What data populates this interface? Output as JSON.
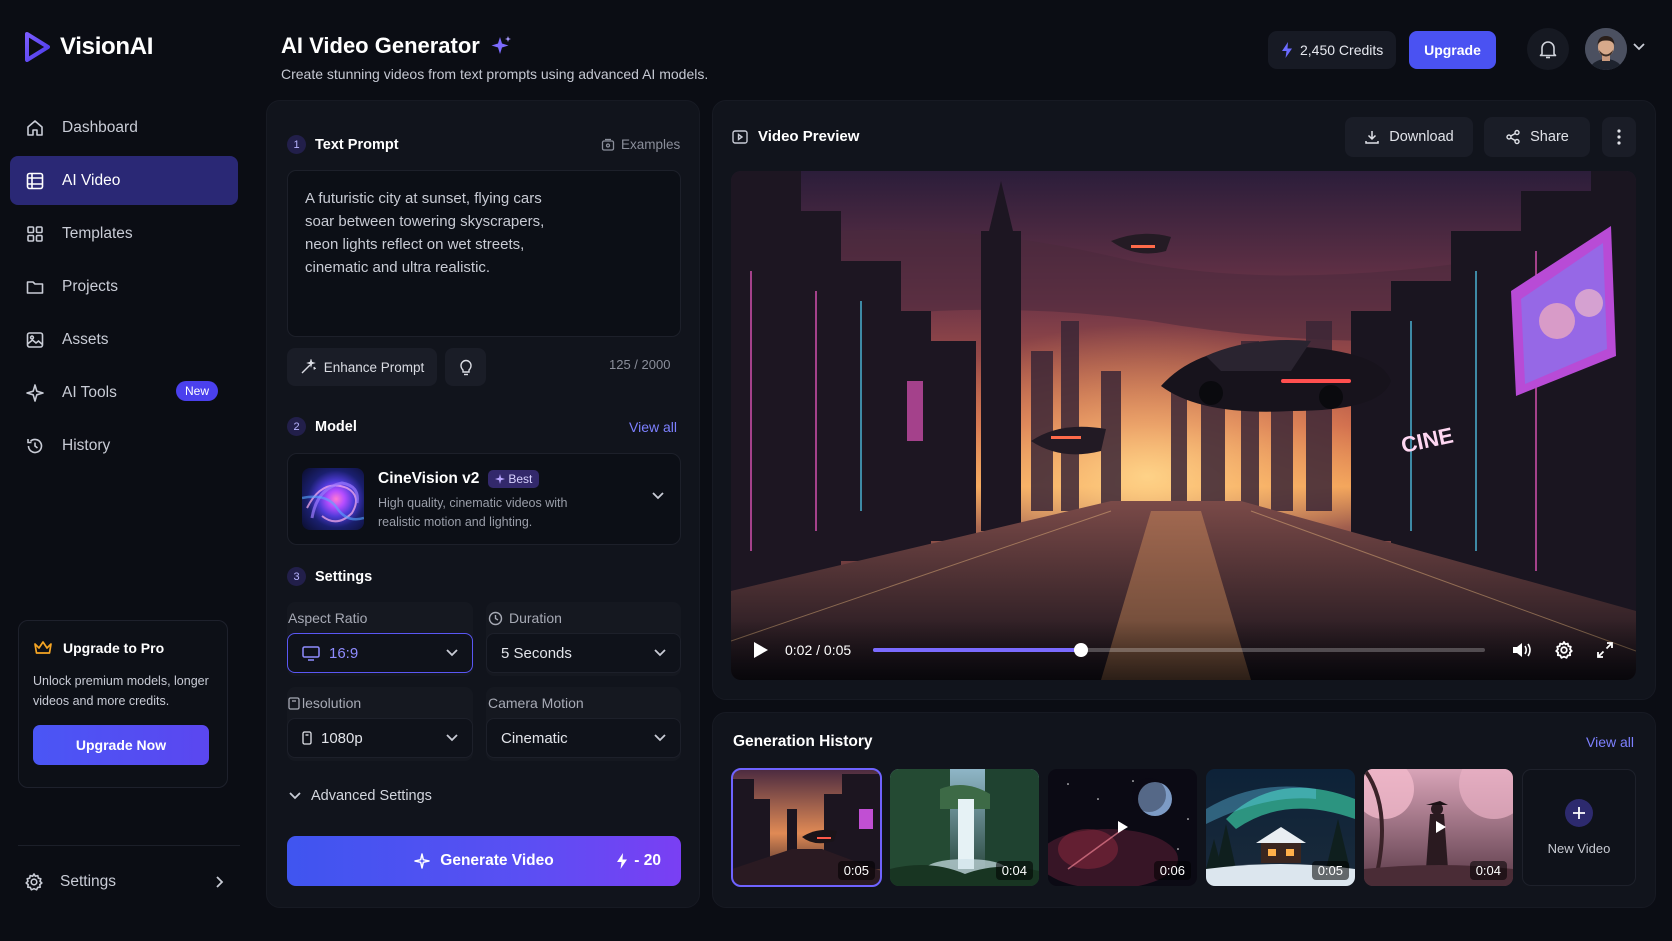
{
  "app": {
    "name": "VisionAI"
  },
  "sidebar": {
    "items": [
      {
        "label": "Dashboard"
      },
      {
        "label": "AI Video"
      },
      {
        "label": "Templates"
      },
      {
        "label": "Projects"
      },
      {
        "label": "Assets"
      },
      {
        "label": "AI Tools",
        "badge": "New"
      },
      {
        "label": "History"
      }
    ],
    "promo": {
      "title": "Upgrade to Pro",
      "text": "Unlock premium models, longer videos and more credits.",
      "button": "Upgrade Now"
    },
    "settings_label": "Settings"
  },
  "header": {
    "title": "AI Video Generator",
    "subtitle": "Create stunning videos from text prompts using advanced AI models.",
    "credits": "2,450 Credits",
    "upgrade": "Upgrade"
  },
  "prompt": {
    "step": "1",
    "title": "Text Prompt",
    "examples": "Examples",
    "text": "A futuristic city at sunset, flying cars soar between towering skyscrapers, neon lights reflect on wet streets, cinematic and ultra realistic.",
    "enhance": "Enhance Prompt",
    "counter": "125 / 2000"
  },
  "model": {
    "step": "2",
    "title": "Model",
    "view_all": "View all",
    "name": "CineVision v2",
    "badge": "Best",
    "description": "High quality, cinematic videos with realistic motion and lighting."
  },
  "settings": {
    "step": "3",
    "title": "Settings",
    "aspect_label": "Aspect Ratio",
    "aspect_value": "16:9",
    "duration_label": "Duration",
    "duration_value": "5 Seconds",
    "resolution_label": "lesolution",
    "resolution_value": "1080p",
    "camera_label": "Camera Motion",
    "camera_value": "Cinematic",
    "advanced": "Advanced Settings"
  },
  "generate": {
    "label": "Generate Video",
    "cost": "- 20"
  },
  "preview": {
    "title": "Video Preview",
    "download": "Download",
    "share": "Share",
    "time": "0:02 / 0:05",
    "progress": 0.34,
    "billboard_text": "CINE"
  },
  "history": {
    "title": "Generation History",
    "view_all": "View all",
    "items": [
      {
        "duration": "0:05",
        "scene": "city-sunset",
        "selected": true
      },
      {
        "duration": "0:04",
        "scene": "waterfall"
      },
      {
        "duration": "0:06",
        "scene": "space"
      },
      {
        "duration": "0:05",
        "scene": "aurora-cabin"
      },
      {
        "duration": "0:04",
        "scene": "samurai-blossom"
      }
    ],
    "new_video": "New Video"
  },
  "colors": {
    "background": "#0b0d14",
    "panel": "#11141c",
    "accent": "#4a52f2",
    "active_nav": "#2a2875",
    "link": "#7d80ff"
  }
}
